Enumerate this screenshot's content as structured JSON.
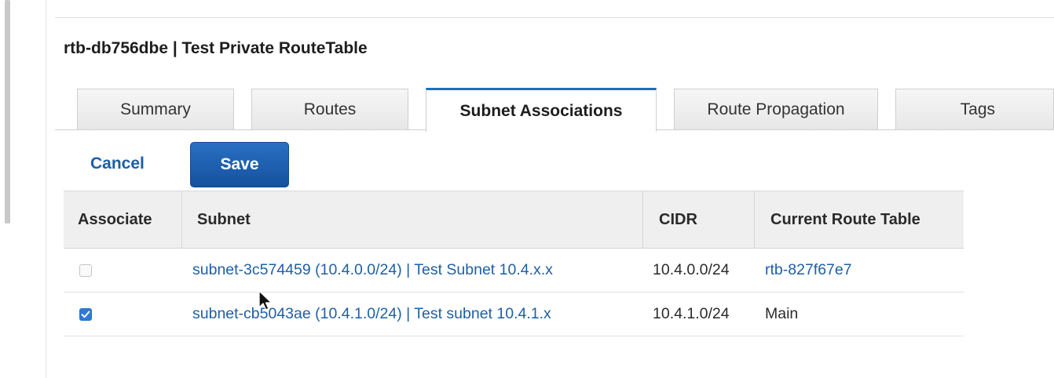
{
  "panel": {
    "title": "rtb-db756dbe | Test Private RouteTable"
  },
  "tabs": [
    {
      "label": "Summary",
      "active": false
    },
    {
      "label": "Routes",
      "active": false
    },
    {
      "label": "Subnet Associations",
      "active": true
    },
    {
      "label": "Route Propagation",
      "active": false
    },
    {
      "label": "Tags",
      "active": false
    }
  ],
  "actions": {
    "cancel_label": "Cancel",
    "save_label": "Save"
  },
  "table": {
    "columns": [
      "Associate",
      "Subnet",
      "CIDR",
      "Current Route Table"
    ],
    "rows": [
      {
        "associate": false,
        "subnet": "subnet-3c574459 (10.4.0.0/24) | Test Subnet 10.4.x.x",
        "cidr": "10.4.0.0/24",
        "route_table": "rtb-827f67e7"
      },
      {
        "associate": true,
        "subnet": "subnet-cb5043ae (10.4.1.0/24) | Test subnet 10.4.1.x",
        "cidr": "10.4.1.0/24",
        "route_table": "Main"
      }
    ]
  },
  "colors": {
    "accent": "#1e6fb8",
    "link": "#1f5fa5",
    "save_button": "#14519e",
    "checkbox_checked": "#2f7ad6"
  },
  "icons": {
    "checkmark": "check-icon",
    "pointer": "mouse-pointer-icon"
  }
}
